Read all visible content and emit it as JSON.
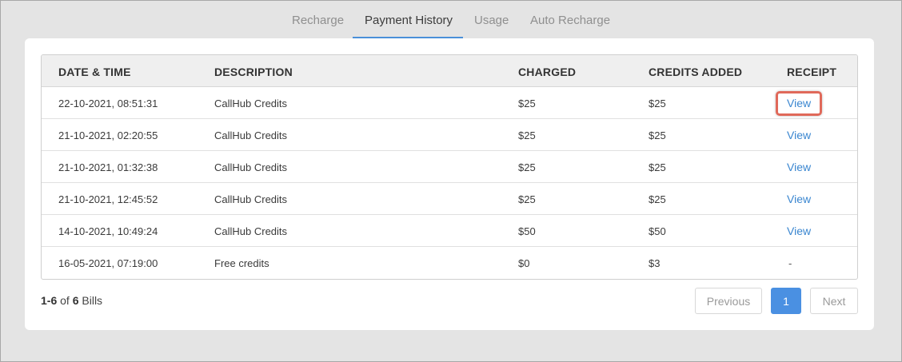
{
  "tabs": [
    {
      "label": "Recharge"
    },
    {
      "label": "Payment History"
    },
    {
      "label": "Usage"
    },
    {
      "label": "Auto Recharge"
    }
  ],
  "table": {
    "headers": [
      "DATE & TIME",
      "DESCRIPTION",
      "CHARGED",
      "CREDITS ADDED",
      "RECEIPT"
    ],
    "rows": [
      {
        "date": "22-10-2021, 08:51:31",
        "description": "CallHub Credits",
        "charged": "$25",
        "credits": "$25",
        "receipt": "View"
      },
      {
        "date": "21-10-2021, 02:20:55",
        "description": "CallHub Credits",
        "charged": "$25",
        "credits": "$25",
        "receipt": "View"
      },
      {
        "date": "21-10-2021, 01:32:38",
        "description": "CallHub Credits",
        "charged": "$25",
        "credits": "$25",
        "receipt": "View"
      },
      {
        "date": "21-10-2021, 12:45:52",
        "description": "CallHub Credits",
        "charged": "$25",
        "credits": "$25",
        "receipt": "View"
      },
      {
        "date": "14-10-2021, 10:49:24",
        "description": "CallHub Credits",
        "charged": "$50",
        "credits": "$50",
        "receipt": "View"
      },
      {
        "date": "16-05-2021, 07:19:00",
        "description": "Free credits",
        "charged": "$0",
        "credits": "$3",
        "receipt": "-"
      }
    ]
  },
  "summary": {
    "range": "1-6",
    "of": "of",
    "total": "6",
    "unit": "Bills"
  },
  "pagination": {
    "previous": "Previous",
    "current": "1",
    "next": "Next"
  },
  "colors": {
    "accent": "#4a90e2",
    "link": "#3a86d0",
    "highlight": "#e0695a"
  }
}
